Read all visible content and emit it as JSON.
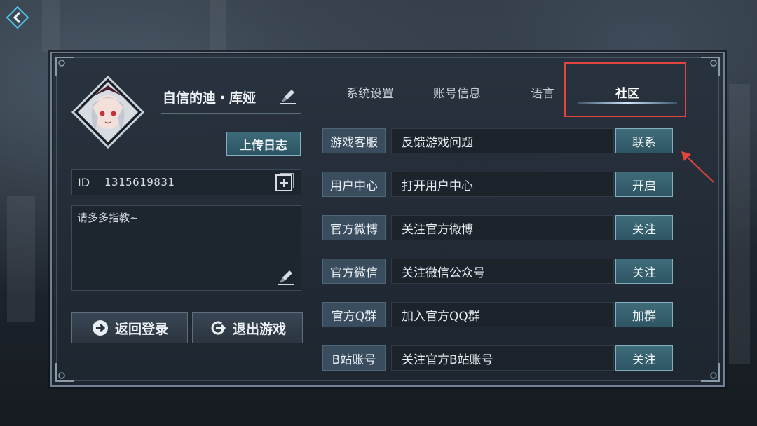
{
  "header": {
    "back_icon": "back-chevron-icon"
  },
  "profile": {
    "name": "自信的迪・库娅",
    "upload_label": "上传日志",
    "id_label": "ID",
    "id_value": "1315619831",
    "signature": "请多多指教~"
  },
  "actions": {
    "back_login": "返回登录",
    "exit_game": "退出游戏"
  },
  "tabs": [
    {
      "label": "系统设置",
      "active": false
    },
    {
      "label": "账号信息",
      "active": false
    },
    {
      "label": "语言",
      "active": false
    },
    {
      "label": "社区",
      "active": true
    }
  ],
  "community": [
    {
      "label": "游戏客服",
      "desc": "反馈游戏问题",
      "button": "联系"
    },
    {
      "label": "用户中心",
      "desc": "打开用户中心",
      "button": "开启"
    },
    {
      "label": "官方微博",
      "desc": "关注官方微博",
      "button": "关注"
    },
    {
      "label": "官方微信",
      "desc": "关注微信公众号",
      "button": "关注"
    },
    {
      "label": "官方Q群",
      "desc": "加入官方QQ群",
      "button": "加群"
    },
    {
      "label": "B站账号",
      "desc": "关注官方B站账号",
      "button": "关注"
    }
  ],
  "colors": {
    "accent": "#7eb0be",
    "highlight": "#e2453b"
  }
}
